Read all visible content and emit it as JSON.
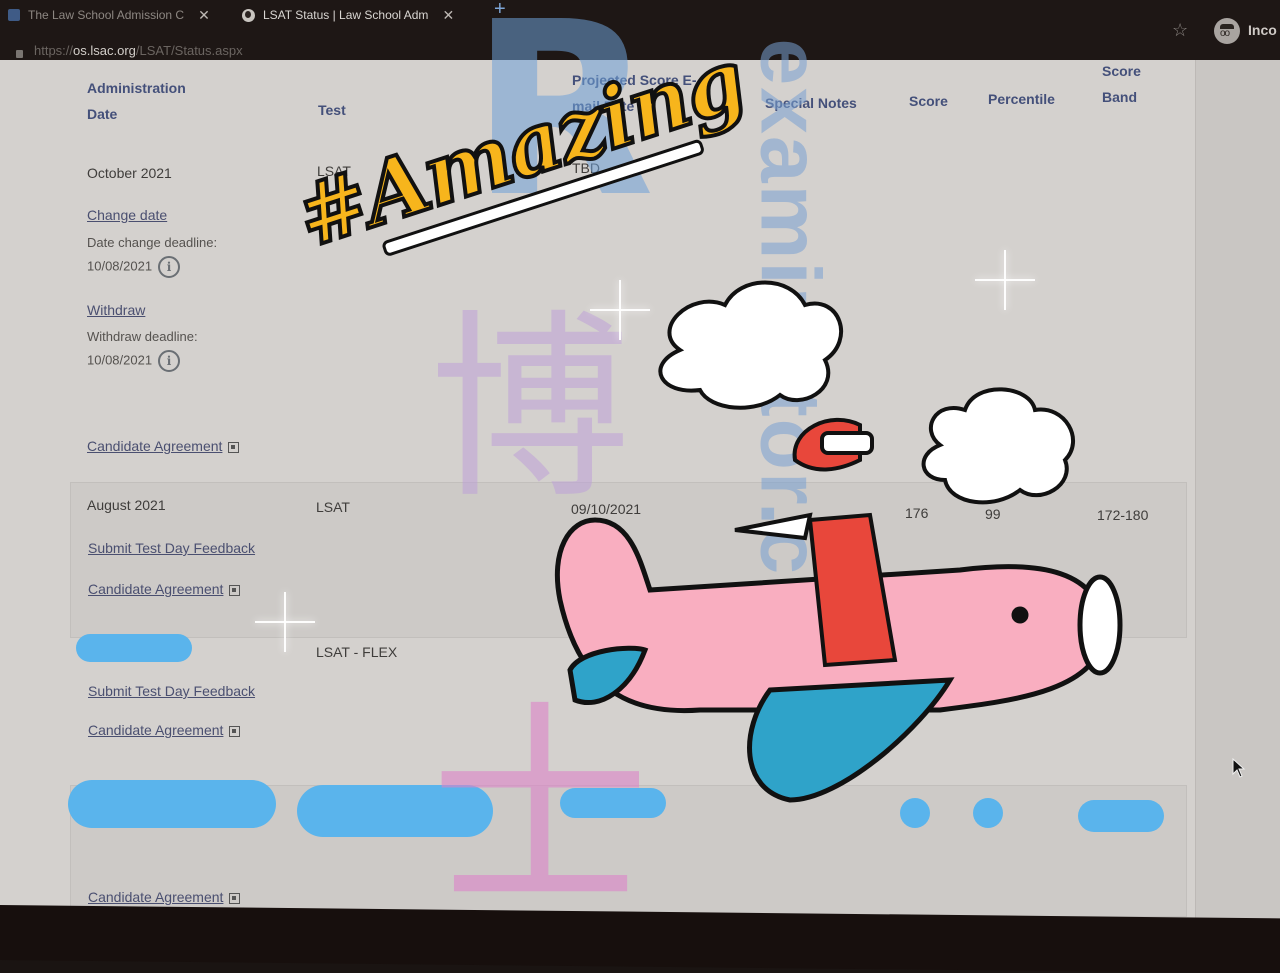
{
  "browser": {
    "tabs": [
      {
        "title": "The Law School Admission C",
        "active": false
      },
      {
        "title": "LSAT Status | Law School Adm",
        "active": true
      }
    ],
    "new_tab_label": "+",
    "url_prefix": "https://",
    "url_host": "os.lsac.org",
    "url_path": "/LSAT/Status.aspx",
    "profile_label": "Inco"
  },
  "table": {
    "headers": {
      "admin_date_1": "Administration",
      "admin_date_2": "Date",
      "test": "Test",
      "projected_1": "Projected Score E-",
      "projected_2": "mail Date",
      "special_notes": "Special Notes",
      "score": "Score",
      "percentile": "Percentile",
      "band_1": "Score",
      "band_2": "Band"
    },
    "rows": [
      {
        "admin_date": "October 2021",
        "test": "LSAT",
        "projected": "TBD",
        "change_date_link": "Change date",
        "date_change_label": "Date change deadline:",
        "date_change_value": "10/08/2021",
        "withdraw_link": "Withdraw",
        "withdraw_label": "Withdraw deadline:",
        "withdraw_value": "10/08/2021",
        "agreement_link": "Candidate Agreement"
      },
      {
        "admin_date": "August 2021",
        "test": "LSAT",
        "projected": "09/10/2021",
        "score": "176",
        "percentile": "99",
        "band": "172-180",
        "feedback_link": "Submit Test Day Feedback",
        "agreement_link": "Candidate Agreement"
      },
      {
        "admin_date": "",
        "test": "LSAT - FLEX",
        "feedback_link": "Submit Test Day Feedback",
        "agreement_link": "Candidate Agreement"
      },
      {
        "agreement_link": "Candidate Agreement"
      }
    ]
  },
  "overlay": {
    "sticker_text": "#Amazing",
    "watermark_latin": "examinator.co",
    "watermark_letter": "R",
    "watermark_cn_1": "博",
    "watermark_cn_2": "士"
  },
  "colors": {
    "redaction": "#5ab4ec",
    "header_text": "#44507a",
    "sticker_yellow": "#f7b51c"
  }
}
